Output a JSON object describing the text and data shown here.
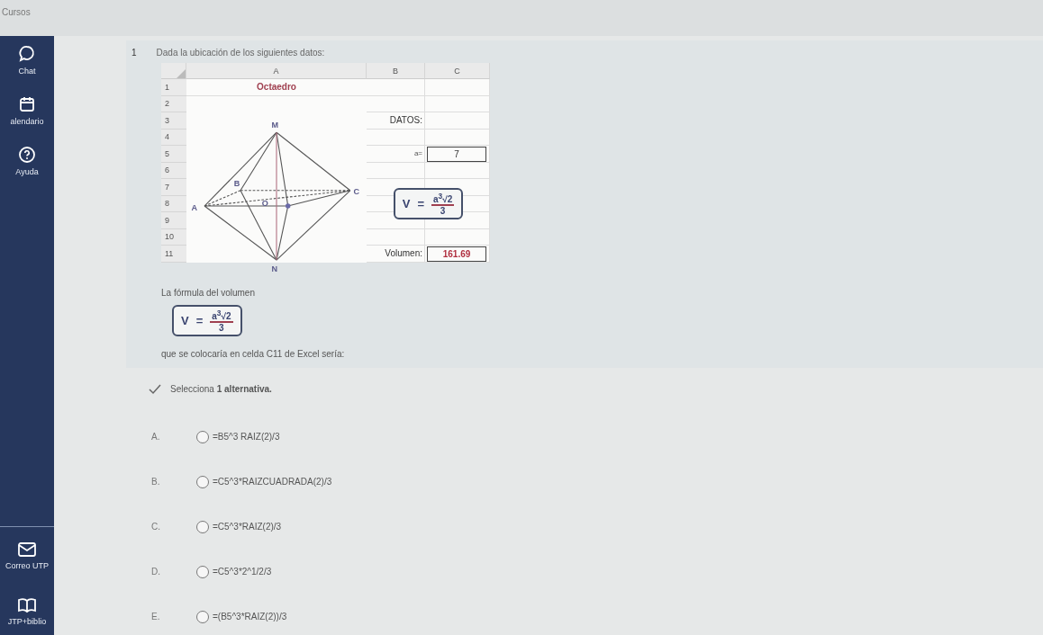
{
  "top_bar": {
    "title": "Cursos"
  },
  "sidebar": {
    "items": [
      {
        "label": "Chat",
        "kind": "chat"
      },
      {
        "label": "alendario",
        "kind": "calendar"
      },
      {
        "label": "Ayuda",
        "kind": "help"
      }
    ],
    "bottom_items": [
      {
        "label": "Correo UTP",
        "kind": "mail"
      },
      {
        "label": "JTP+biblio",
        "kind": "book"
      }
    ]
  },
  "question": {
    "number": "1",
    "intro": "Dada la ubicación de los siguientes datos:",
    "sheet": {
      "columns": [
        "A",
        "B",
        "C"
      ],
      "rows": [
        "1",
        "2",
        "3",
        "4",
        "5",
        "6",
        "7",
        "8",
        "9",
        "10",
        "11"
      ],
      "title": "Octaedro",
      "vertices": [
        "M",
        "A",
        "B",
        "C",
        "N",
        "O"
      ],
      "datos_label": "DATOS:",
      "a_label": "a=",
      "a_value": "7",
      "formula": {
        "lhs": "V",
        "eq": "=",
        "numerator": "a$^{3}$√2",
        "denominator": "3"
      },
      "volume_label": "Volumen:",
      "volume_value": "161.69"
    },
    "formula_caption": "La fórmula del volumen",
    "formula": {
      "lhs": "V",
      "eq": "=",
      "numerator": "a$^{3}$√2",
      "denominator": "3"
    },
    "prompt": "que se colocaría en celda C11 de Excel sería:"
  },
  "instruction": "Selecciona **1 alternativa.**",
  "options": [
    {
      "letter": "A.",
      "text": "=B5^3 RAIZ(2)/3",
      "selected": false
    },
    {
      "letter": "B.",
      "text": "=C5^3*RAIZCUADRADA(2)/3",
      "selected": false
    },
    {
      "letter": "C.",
      "text": "=C5^3*RAIZ(2)/3",
      "selected": false
    },
    {
      "letter": "D.",
      "text": "=C5^3*2^1/2/3",
      "selected": false
    },
    {
      "letter": "E.",
      "text": "=(B5^3*RAIZ(2))/3",
      "selected": false
    }
  ]
}
